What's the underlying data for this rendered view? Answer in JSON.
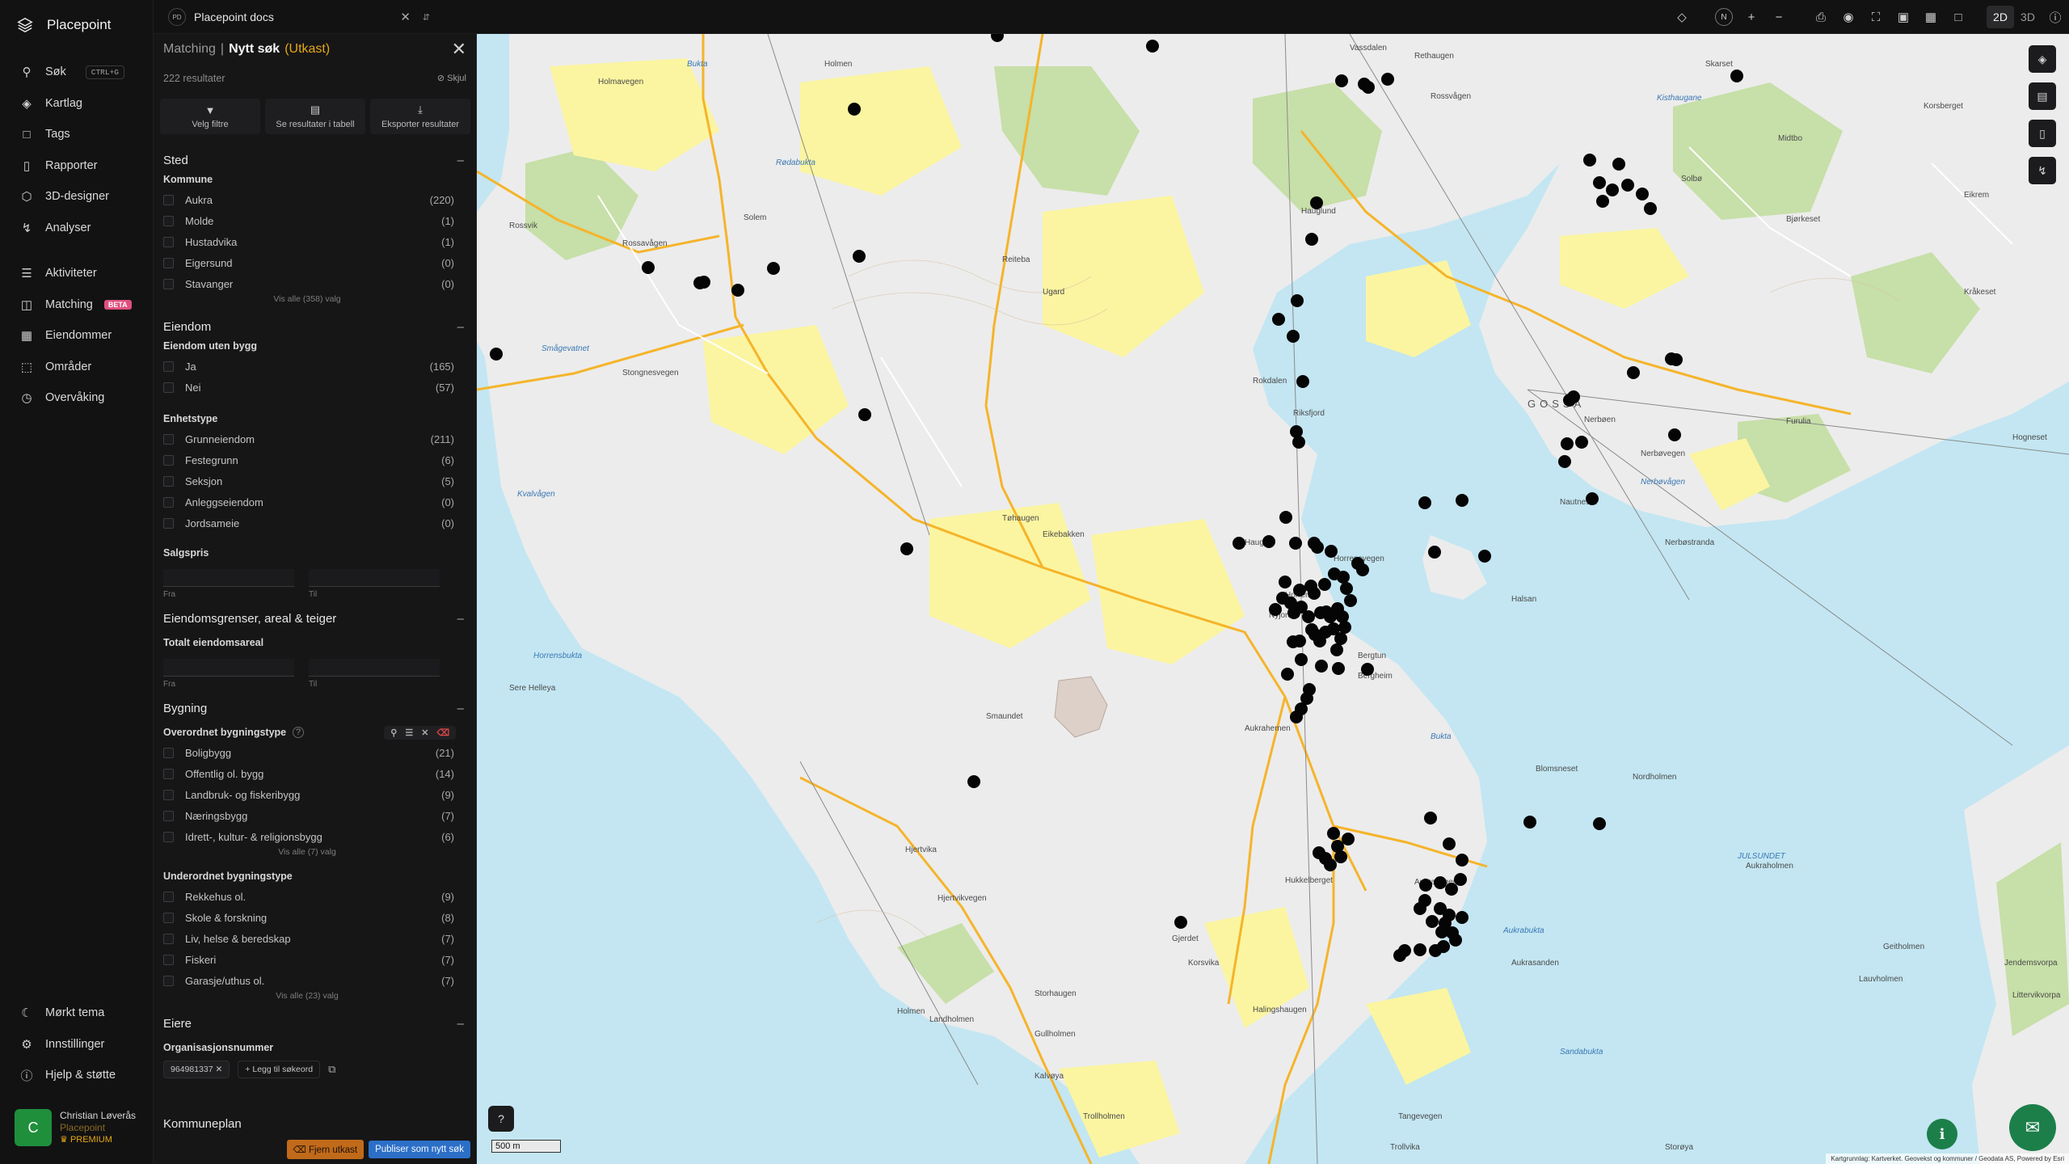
{
  "app": {
    "name": "Placepoint"
  },
  "nav": {
    "items": [
      {
        "label": "Søk",
        "icon": "search-icon",
        "kbd": "CTRL+G"
      },
      {
        "label": "Kartlag",
        "icon": "layers-icon"
      },
      {
        "label": "Tags",
        "icon": "bookmark-icon"
      },
      {
        "label": "Rapporter",
        "icon": "chart-icon"
      },
      {
        "label": "3D-designer",
        "icon": "cube-icon"
      },
      {
        "label": "Analyser",
        "icon": "bolt-icon"
      }
    ],
    "items2": [
      {
        "label": "Aktiviteter",
        "icon": "activity-icon"
      },
      {
        "label": "Matching",
        "icon": "matching-icon",
        "badge": "BETA"
      },
      {
        "label": "Eiendommer",
        "icon": "building-icon"
      },
      {
        "label": "Områder",
        "icon": "area-icon"
      },
      {
        "label": "Overvåking",
        "icon": "monitor-icon"
      }
    ],
    "bottom": [
      {
        "label": "Mørkt tema",
        "icon": "moon-icon"
      },
      {
        "label": "Innstillinger",
        "icon": "gear-icon"
      },
      {
        "label": "Hjelp & støtte",
        "icon": "help-icon"
      }
    ],
    "user": {
      "initial": "C",
      "name": "Christian Løverås",
      "org": "Placepoint",
      "tier": "PREMIUM"
    }
  },
  "topbar": {
    "doc_badge": "PD",
    "doc_name": "Placepoint docs",
    "compass": "N",
    "mode_2d": "2D",
    "mode_3d": "3D"
  },
  "panel": {
    "crumb": "Matching",
    "sep": "|",
    "title": "Nytt søk",
    "draft": "(Utkast)",
    "result_count": "222 resultater",
    "hide": "Skjul",
    "actions": [
      {
        "label": "Velg filtre",
        "icon": "filter-icon"
      },
      {
        "label": "Se resultater i tabell",
        "icon": "table-icon"
      },
      {
        "label": "Eksporter resultater",
        "icon": "download-icon"
      }
    ],
    "sted": {
      "title": "Sted",
      "kommune_label": "Kommune",
      "rows": [
        {
          "label": "Aukra",
          "count": "(220)"
        },
        {
          "label": "Molde",
          "count": "(1)"
        },
        {
          "label": "Hustadvika",
          "count": "(1)"
        },
        {
          "label": "Eigersund",
          "count": "(0)"
        },
        {
          "label": "Stavanger",
          "count": "(0)"
        }
      ],
      "more": "Vis alle (358) valg"
    },
    "eiendom": {
      "title": "Eiendom",
      "uten_bygg_label": "Eiendom uten bygg",
      "uten_bygg_rows": [
        {
          "label": "Ja",
          "count": "(165)"
        },
        {
          "label": "Nei",
          "count": "(57)"
        }
      ],
      "enhetstype_label": "Enhetstype",
      "enhetstype_rows": [
        {
          "label": "Grunneiendom",
          "count": "(211)"
        },
        {
          "label": "Festegrunn",
          "count": "(6)"
        },
        {
          "label": "Seksjon",
          "count": "(5)"
        },
        {
          "label": "Anleggseiendom",
          "count": "(0)"
        },
        {
          "label": "Jordsameie",
          "count": "(0)"
        }
      ],
      "salgspris_label": "Salgspris",
      "from": "Fra",
      "to": "Til"
    },
    "grenser": {
      "title": "Eiendomsgrenser, areal & teiger",
      "areal_label": "Totalt eiendomsareal"
    },
    "bygning": {
      "title": "Bygning",
      "overordnet_label": "Overordnet bygningstype",
      "overordnet_rows": [
        {
          "label": "Boligbygg",
          "count": "(21)"
        },
        {
          "label": "Offentlig ol. bygg",
          "count": "(14)"
        },
        {
          "label": "Landbruk- og fiskeribygg",
          "count": "(9)"
        },
        {
          "label": "Næringsbygg",
          "count": "(7)"
        },
        {
          "label": "Idrett-, kultur- & religionsbygg",
          "count": "(6)"
        }
      ],
      "overordnet_more": "Vis alle (7) valg",
      "underordnet_label": "Underordnet bygningstype",
      "underordnet_rows": [
        {
          "label": "Rekkehus ol.",
          "count": "(9)"
        },
        {
          "label": "Skole & forskning",
          "count": "(8)"
        },
        {
          "label": "Liv, helse & beredskap",
          "count": "(7)"
        },
        {
          "label": "Fiskeri",
          "count": "(7)"
        },
        {
          "label": "Garasje/uthus ol.",
          "count": "(7)"
        }
      ],
      "underordnet_more": "Vis alle (23) valg"
    },
    "eiere": {
      "title": "Eiere",
      "org_label": "Organisasjonsnummer",
      "org_value": "964981337",
      "add_label": "Legg til søkeord"
    },
    "kommuneplan": "Kommuneplan",
    "remove_draft": "Fjern utkast",
    "publish": "Publiser som nytt søk"
  },
  "map": {
    "colors": {
      "water": "#c3e6f2",
      "land": "#ececec",
      "green": "#c7dfa8",
      "yellow": "#fbf5a1",
      "road": "#f5b42a"
    },
    "labels": [
      "Holmavegen",
      "Bukta",
      "Holmen",
      "Vassdalen",
      "Rethaugen",
      "Skarset",
      "Korsberget",
      "Rødabukta",
      "Kisthaugane",
      "Midtbo",
      "Solbø",
      "Eikrem",
      "Bjørkeset",
      "Rossvågen",
      "Rossvik",
      "Solem",
      "Rossavågen",
      "Reiteba",
      "Ugard",
      "Hauglund",
      "Kråkeset",
      "Smågevatnet",
      "Stongnesvegen",
      "GOSSA",
      "Rokdalen",
      "Riksfjord",
      "Nerbøen",
      "Nerbøvegen",
      "Furulia",
      "Hogneset",
      "Nerbøvågen",
      "Nautneset",
      "Nerbøstranda",
      "Kvalvågen",
      "Tøhaugen",
      "Eikebakken",
      "Haugen",
      "Horrem",
      "Horrensvegen",
      "Nyjordet",
      "Bergtun",
      "Bergheim",
      "Halsan",
      "Horrensbukta",
      "Sere Helleya",
      "Smaundet",
      "Aukrahemen",
      "Bukta",
      "Blomsneset",
      "Nordholmen",
      "JULSUNDET",
      "Hjertvika",
      "Hjertvikvegen",
      "Holmen",
      "Landholmen",
      "Hukkelberget",
      "Aukravegen",
      "Aukrabukta",
      "Aukrasanden",
      "Aukraholmen",
      "Geitholmen",
      "Lauvholmen",
      "Gjerdet",
      "Korsvika",
      "Storhaugen",
      "Halingshaugen",
      "Gullholmen",
      "Kalvøya",
      "Trollholmen",
      "Sandabukta",
      "Tangevegen",
      "Trollvika",
      "Littervikvorpa",
      "Jendemsvorpa",
      "Storøya"
    ],
    "scale": "500 m",
    "attribution": "Kartgrunnlag: Kartverket. Geovekst og kommuner / Geodata AS, Powered by Esri"
  }
}
